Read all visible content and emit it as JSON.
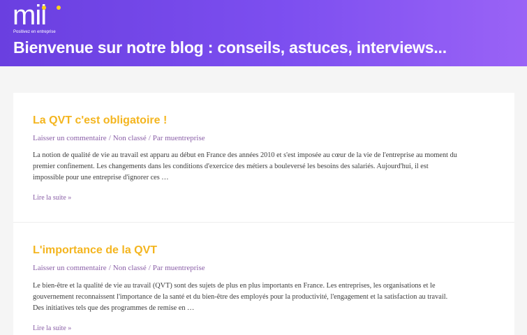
{
  "colors": {
    "header_gradient_start": "#6a3fe0",
    "header_gradient_end": "#9a63f6",
    "accent_title": "#f4b51f",
    "link_purple": "#8a5fa7",
    "logo_dot": "#ffd21a"
  },
  "header": {
    "logo_text": "mii",
    "logo_tagline": "Positivez en entreprise",
    "title": "Bienvenue sur notre blog : conseils, astuces, interviews..."
  },
  "posts": [
    {
      "title": "La QVT c'est obligatoire !",
      "meta": {
        "comments": "Laisser un commentaire",
        "separator": "/",
        "category": "Non classé",
        "author_prefix": "Par",
        "author": "muentreprise"
      },
      "excerpt_lines": [
        "La notion de qualité de vie au travail est apparu au début en France des années 2010 et s'est imposée au cœur de la vie de l'entreprise au moment du",
        "premier confinement. Les changements dans les conditions d'exercice des métiers a bouleversé les besoins des salariés. Aujourd'hui, il est",
        "impossible pour une entreprise d'ignorer ces …"
      ],
      "read_more": "Lire la suite »"
    },
    {
      "title": "L'importance de la QVT",
      "meta": {
        "comments": "Laisser un commentaire",
        "separator": "/",
        "category": "Non classé",
        "author_prefix": "Par",
        "author": "muentreprise"
      },
      "excerpt_lines": [
        "Le bien-être et la qualité de vie au travail (QVT) sont des sujets de plus en plus importants en France. Les entreprises, les organisations et le",
        "gouvernement reconnaissent l'importance de la santé et du bien-être des employés pour la productivité, l'engagement et la satisfaction au travail.",
        "Des initiatives tels que des programmes de remise en …"
      ],
      "read_more": "Lire la suite »"
    }
  ]
}
